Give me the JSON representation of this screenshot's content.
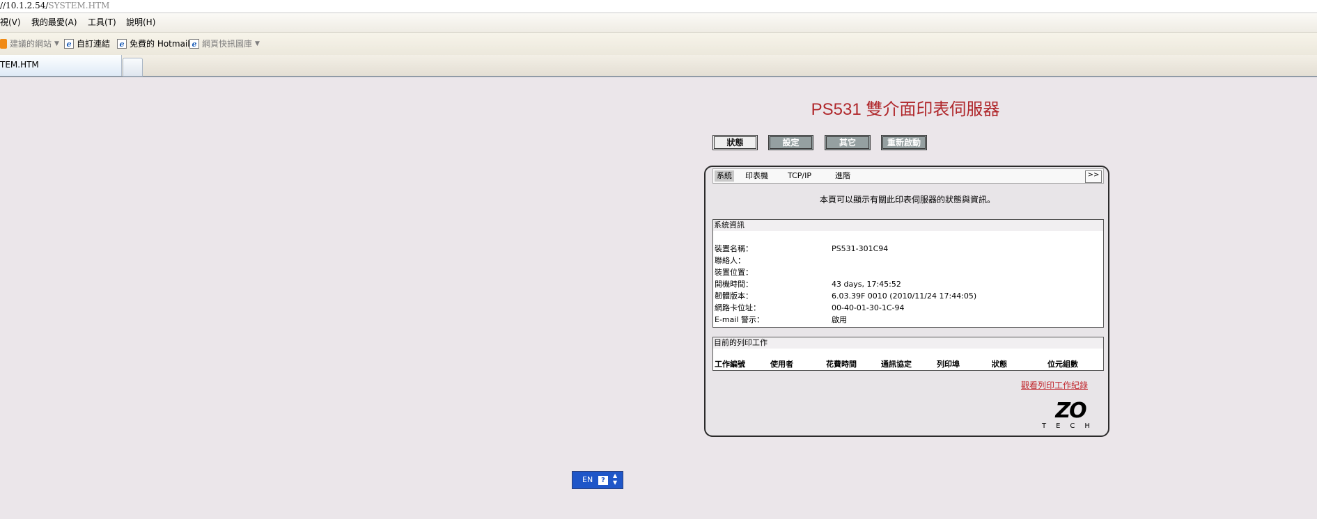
{
  "address": {
    "prefix": "//10.1.2.54/",
    "path": "SYSTEM.HTM"
  },
  "menu": [
    "視(V)",
    "我的最愛(A)",
    "工具(T)",
    "說明(H)"
  ],
  "favorites": [
    "建議的網站",
    "自訂連結",
    "免費的 Hotmail",
    "網頁快訊圖庫"
  ],
  "tab": {
    "title": "TEM.HTM"
  },
  "page": {
    "title": "PS531 雙介面印表伺服器",
    "nav": [
      "狀態",
      "設定",
      "其它",
      "重新啟動"
    ],
    "subtabs": [
      "系統",
      "印表機",
      "TCP/IP",
      "進階"
    ],
    "more_label": ">>",
    "description": "本頁可以顯示有關此印表伺服器的狀態與資訊。",
    "system": {
      "title": "系統資訊",
      "rows": [
        {
          "label": "裝置名稱：",
          "value": "PS531-301C94"
        },
        {
          "label": "聯絡人：",
          "value": ""
        },
        {
          "label": "裝置位置：",
          "value": ""
        },
        {
          "label": "開機時間：",
          "value": "43 days, 17:45:52"
        },
        {
          "label": "韌體版本：",
          "value": "6.03.39F 0010 (2010/11/24 17:44:05)"
        },
        {
          "label": "網路卡位址：",
          "value": "00-40-01-30-1C-94"
        },
        {
          "label": "E-mail 警示：",
          "value": "啟用"
        }
      ]
    },
    "jobs": {
      "title": "目前的列印工作",
      "columns": [
        "工作編號",
        "使用者",
        "花費時間",
        "通訊協定",
        "列印埠",
        "狀態",
        "位元組數"
      ]
    },
    "link": "觀看列印工作紀錄",
    "logo": {
      "big": "ZO",
      "small": "TECH"
    }
  },
  "langbar": {
    "lang": "EN",
    "help": "?"
  }
}
